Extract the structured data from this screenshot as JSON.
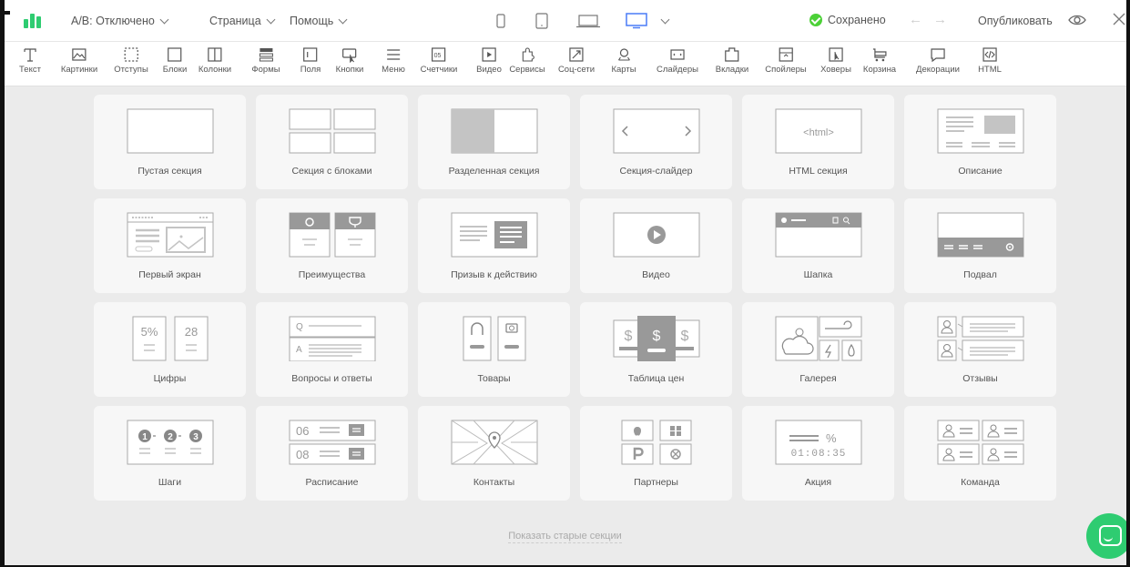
{
  "topbar": {
    "ab_label": "А/В: Отключено",
    "page_label": "Страница",
    "help_label": "Помощь",
    "saved_label": "Сохранено",
    "publish_label": "Опубликовать"
  },
  "colors": {
    "accent": "#2ecc71",
    "saved_check": "#4cd137",
    "active_device": "#4a7cf7",
    "card_bg": "#f7f7f7",
    "page_bg": "#ebebeb"
  },
  "devices": [
    "phone-icon",
    "tablet-icon",
    "laptop-icon",
    "desktop-icon"
  ],
  "toolbar": {
    "items": [
      {
        "label": "Текст",
        "icon": "text-icon"
      },
      {
        "label": "Картинки",
        "icon": "image-icon"
      },
      {
        "label": "Отступы",
        "icon": "spacing-icon"
      },
      {
        "label": "Блоки",
        "icon": "block-icon"
      },
      {
        "label": "Колонки",
        "icon": "columns-icon"
      },
      {
        "label": "Формы",
        "icon": "forms-icon"
      },
      {
        "label": "Поля",
        "icon": "fields-icon"
      },
      {
        "label": "Кнопки",
        "icon": "buttons-icon"
      },
      {
        "label": "Меню",
        "icon": "menu-icon"
      },
      {
        "label": "Счетчики",
        "icon": "counters-icon"
      },
      {
        "label": "Видео",
        "icon": "video-icon"
      },
      {
        "label": "Сервисы",
        "icon": "services-icon"
      },
      {
        "label": "Соц-сети",
        "icon": "social-icon"
      },
      {
        "label": "Карты",
        "icon": "maps-icon"
      },
      {
        "label": "Слайдеры",
        "icon": "sliders-icon"
      },
      {
        "label": "Вкладки",
        "icon": "tabs-icon"
      },
      {
        "label": "Спойлеры",
        "icon": "spoilers-icon"
      },
      {
        "label": "Ховеры",
        "icon": "hovers-icon"
      },
      {
        "label": "Корзина",
        "icon": "cart-icon"
      },
      {
        "label": "Декорации",
        "icon": "decorations-icon"
      },
      {
        "label": "HTML",
        "icon": "html-icon"
      }
    ]
  },
  "sections": [
    {
      "label": "Пустая секция",
      "thumb": "empty"
    },
    {
      "label": "Секция с блоками",
      "thumb": "blocks"
    },
    {
      "label": "Разделенная секция",
      "thumb": "split"
    },
    {
      "label": "Секция-слайдер",
      "thumb": "slider"
    },
    {
      "label": "HTML секция",
      "thumb": "html",
      "thumb_text": "<html>"
    },
    {
      "label": "Описание",
      "thumb": "description"
    },
    {
      "label": "Первый экран",
      "thumb": "hero"
    },
    {
      "label": "Преимущества",
      "thumb": "features"
    },
    {
      "label": "Призыв к действию",
      "thumb": "cta"
    },
    {
      "label": "Видео",
      "thumb": "video"
    },
    {
      "label": "Шапка",
      "thumb": "header"
    },
    {
      "label": "Подвал",
      "thumb": "footer"
    },
    {
      "label": "Цифры",
      "thumb": "numbers",
      "thumb_text": [
        "5%",
        "28"
      ]
    },
    {
      "label": "Вопросы и ответы",
      "thumb": "faq",
      "thumb_text": [
        "Q",
        "A"
      ]
    },
    {
      "label": "Товары",
      "thumb": "products"
    },
    {
      "label": "Таблица цен",
      "thumb": "pricing",
      "thumb_text": "$"
    },
    {
      "label": "Галерея",
      "thumb": "gallery"
    },
    {
      "label": "Отзывы",
      "thumb": "reviews"
    },
    {
      "label": "Шаги",
      "thumb": "steps",
      "thumb_text": [
        "1",
        "2",
        "3"
      ]
    },
    {
      "label": "Расписание",
      "thumb": "schedule",
      "thumb_text": [
        "06",
        "08"
      ]
    },
    {
      "label": "Контакты",
      "thumb": "contacts"
    },
    {
      "label": "Партнеры",
      "thumb": "partners"
    },
    {
      "label": "Акция",
      "thumb": "promo",
      "thumb_text": [
        "%",
        "01:08:35"
      ]
    },
    {
      "label": "Команда",
      "thumb": "team"
    }
  ],
  "show_old_sections": "Показать старые секции"
}
